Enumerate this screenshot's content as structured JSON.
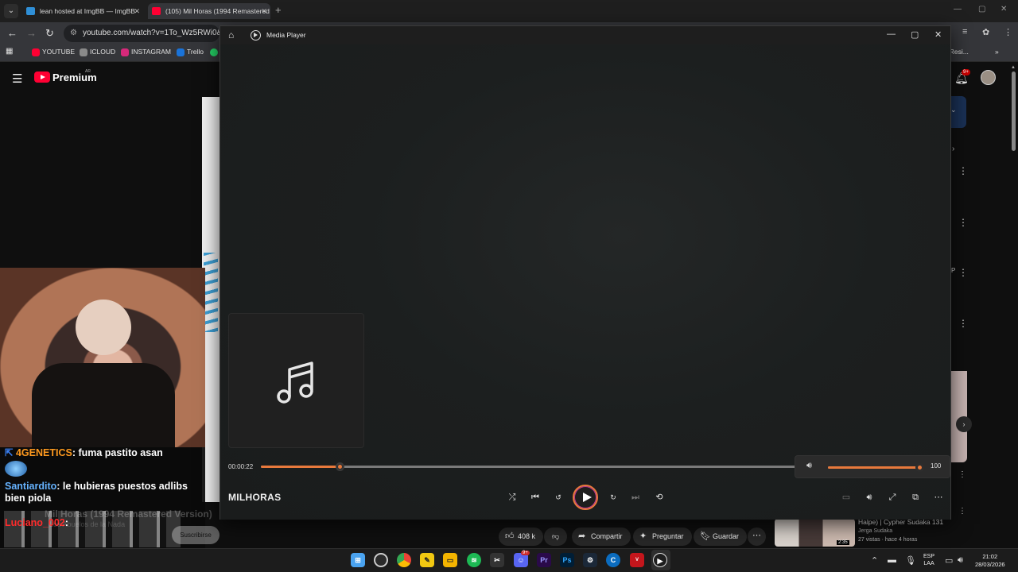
{
  "browser": {
    "tabs": [
      {
        "title": "lean hosted at ImgBB — ImgBB",
        "favicon_color": "#2f8fd6"
      },
      {
        "title": "(105) Mil Horas (1994 Remastered",
        "favicon_color": "#ff0033"
      }
    ],
    "url": "youtube.com/watch?v=1To_Wz5RWi0&lis",
    "bookmarks": [
      {
        "label": "YOUTUBE",
        "color": "#ff0033"
      },
      {
        "label": "ICLOUD",
        "color": "#8a8a8a"
      },
      {
        "label": "INSTAGRAM",
        "color": "#d6297a"
      },
      {
        "label": "Trello",
        "color": "#1a73d9"
      }
    ],
    "right_partial": "r | Resi..."
  },
  "youtube": {
    "brand": "Premium",
    "region": "AR",
    "notifications": "9+",
    "actions": {
      "likes": "408 k",
      "share": "Compartir",
      "ask": "Preguntar",
      "save": "Guardar"
    },
    "recommendation": {
      "title": "Halpe) | Cypher Sudaka 131",
      "channel": "Jerga Sudaka",
      "meta": "27 vistas · hace 4 horas",
      "duration": "2:35"
    },
    "subscribe": "Suscribirse"
  },
  "chat": {
    "messages": [
      {
        "user": "4GENETICS",
        "text": ": fuma pastito asan",
        "user_style": "rainbow"
      },
      {
        "user": "Santiardito",
        "text": ": le hubieras puestos adlibs bien piola",
        "user_style": "blue"
      },
      {
        "user": "Luciano_002",
        "text": ":",
        "user_style": "red"
      }
    ],
    "ghost_title": "Mil Horas (1994 Remastered Version)",
    "ghost_subtitle": "Los Abuelos de la Nada"
  },
  "media_player": {
    "app_title": "Media Player",
    "track_title": "MILHORAS",
    "elapsed": "00:00:22",
    "progress": 0.145,
    "volume": 100,
    "accent": "#e8793c"
  },
  "taskbar": {
    "language": "ESP",
    "layout": "LAA",
    "time": "21:02",
    "date": "28/03/2026",
    "discord_badge": "9+"
  }
}
